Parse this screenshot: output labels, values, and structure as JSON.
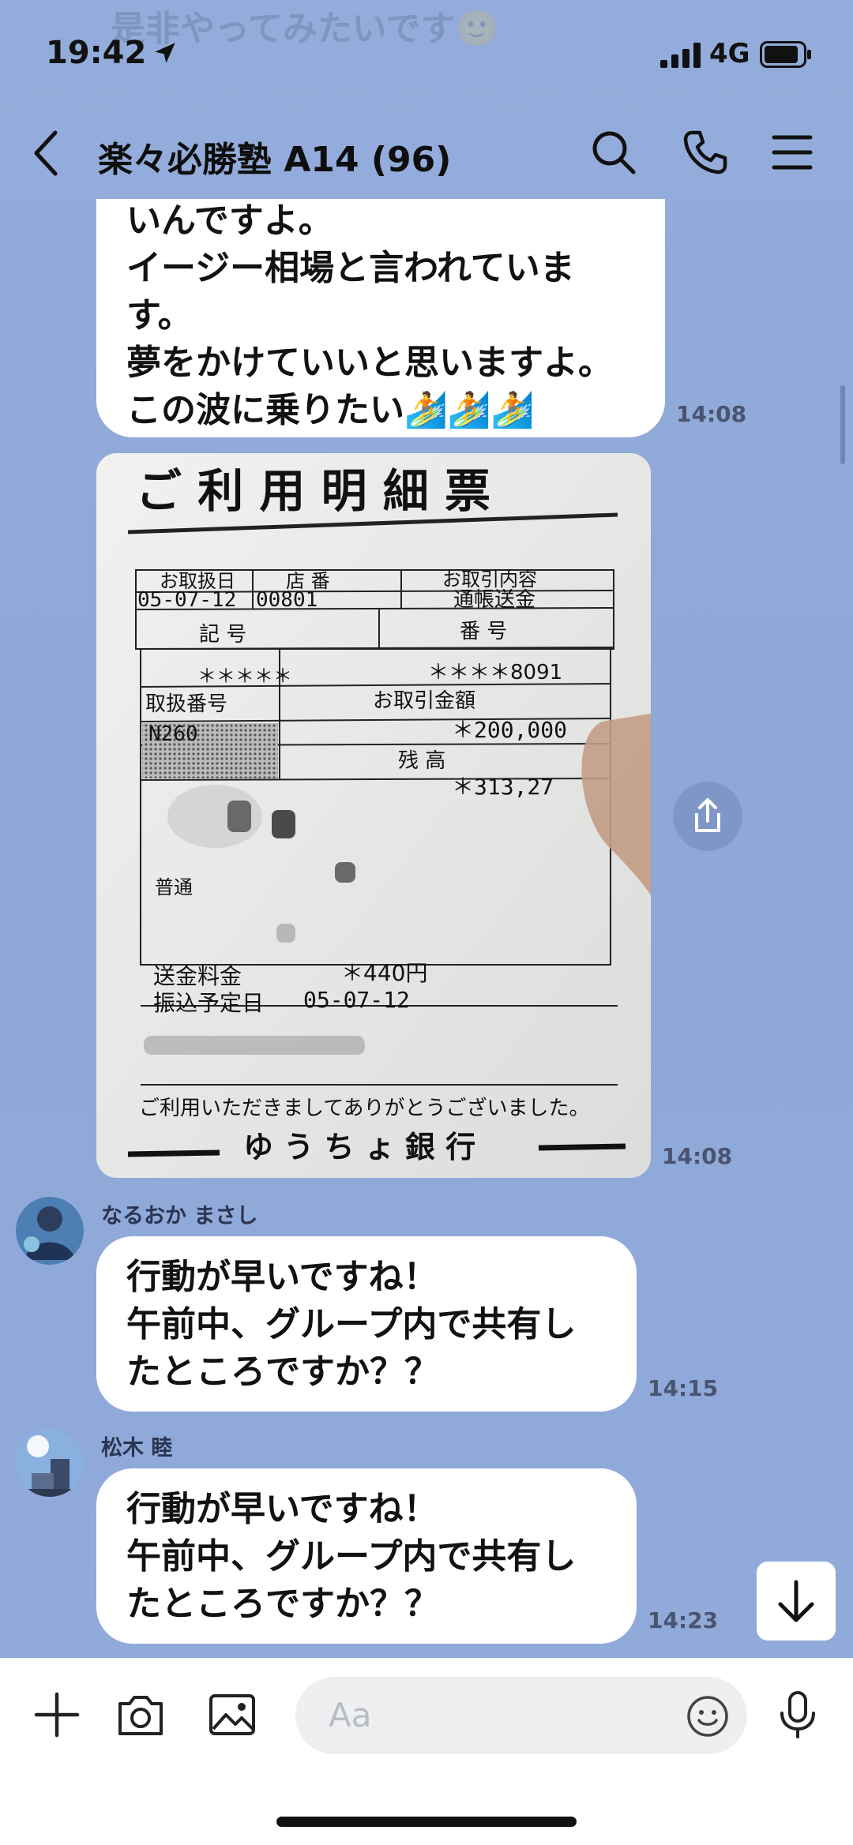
{
  "status_bar": {
    "time": "19:42",
    "network": "4G"
  },
  "background_peek": {
    "top_text": "是非やってみたいです🙂"
  },
  "header": {
    "title": "楽々必勝塾 A14 (96)"
  },
  "messages": [
    {
      "lines": [
        "いんですよ。",
        "イージー相場と言われていま",
        "す。",
        "夢をかけていいと思いますよ。",
        "この波に乗りたい🏄🏄🏄"
      ],
      "time": "14:08"
    },
    {
      "type": "image",
      "time": "14:08",
      "receipt": {
        "title": "ご 利 用 明 細 票",
        "h1": "お取扱日",
        "h2": "店 番",
        "h3": "お取引内容",
        "v1": "05-07-12",
        "v2": "00801",
        "v3": "通帳送金",
        "h4": "記 号",
        "h5": "番 号",
        "v4": "＊＊＊＊＊",
        "v5": "＊＊＊＊8091",
        "h6": "取扱番号",
        "h7": "お取引金額",
        "v6": "N260",
        "v7": "＊200,000",
        "h8": "残 高",
        "v8": "＊313,27",
        "account_type": "普通",
        "fee_label": "送金料金",
        "fee": "＊440円",
        "date_label": "振込予定日",
        "date": "05-07-12",
        "thanks": "ご利用いただきましてありがとうございました。",
        "bank": "ゆ う ち ょ 銀 行"
      }
    },
    {
      "sender": "なるおか まさし",
      "lines": [
        "行動が早いですね！",
        "午前中、グループ内で共有し",
        "たところですか？？"
      ],
      "time": "14:15"
    },
    {
      "sender": "松木 睦",
      "lines": [
        "行動が早いですね！",
        "午前中、グループ内で共有し",
        "たところですか？？"
      ],
      "time": "14:23"
    }
  ],
  "composer": {
    "placeholder": "Aa"
  },
  "icons": {
    "header": [
      "back-arrow-icon",
      "search-icon",
      "phone-icon",
      "menu-icon"
    ],
    "composer": [
      "plus-icon",
      "camera-icon",
      "image-icon",
      "emoji-icon",
      "microphone-icon"
    ],
    "other": [
      "share-icon",
      "arrow-down-icon"
    ]
  }
}
